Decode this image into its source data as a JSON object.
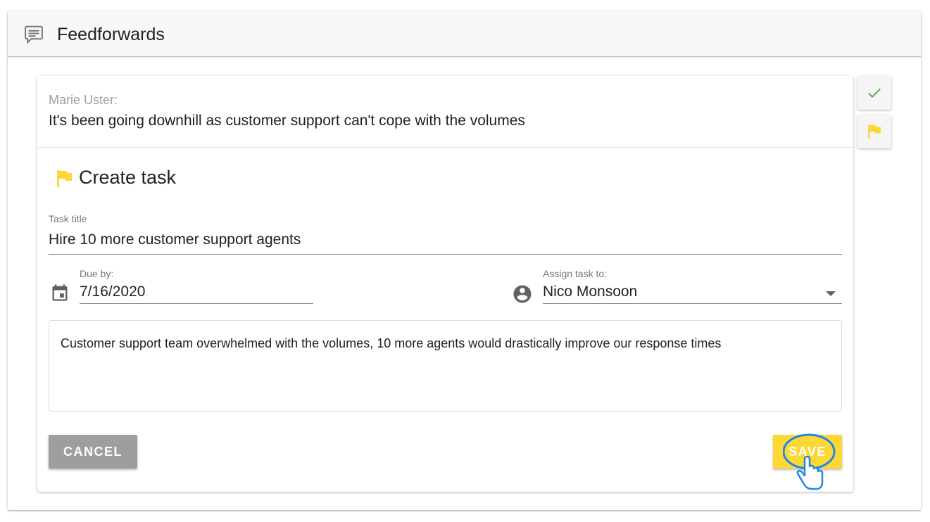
{
  "header": {
    "title": "Feedforwards",
    "icon": "chat-feedback-icon"
  },
  "feedback": {
    "author": "Marie Uster:",
    "message": "It's been going downhill as customer support can't cope with the volumes"
  },
  "task_form": {
    "heading": "Create task",
    "title_label": "Task title",
    "title_value": "Hire 10 more customer support agents",
    "due_label": "Due by:",
    "due_value": "7/16/2020",
    "assign_label": "Assign task to:",
    "assign_value": "Nico Monsoon",
    "description": "Customer support team overwhelmed with the volumes, 10 more agents would drastically improve our response times",
    "cancel_label": "CANCEL",
    "save_label": "SAVE"
  },
  "side_actions": [
    {
      "name": "approve-button",
      "icon": "check-icon"
    },
    {
      "name": "create-task-button",
      "icon": "flag-icon"
    }
  ],
  "colors": {
    "accent_yellow": "#fdd835",
    "check_green": "#4caf50",
    "cancel_gray": "#9e9e9e",
    "cursor_blue": "#1e88e5"
  }
}
